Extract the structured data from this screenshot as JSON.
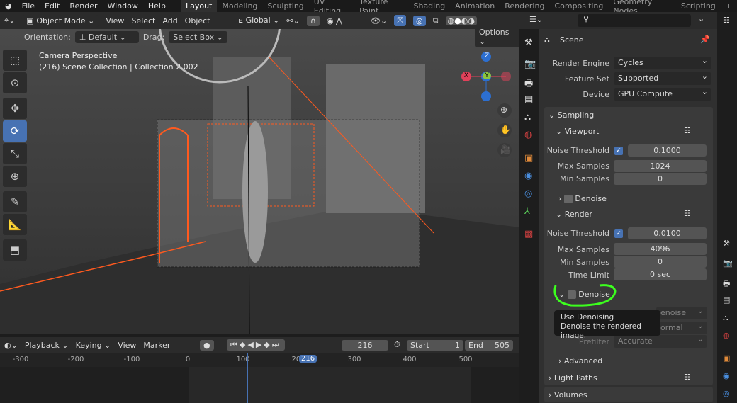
{
  "menu": {
    "items": [
      "File",
      "Edit",
      "Render",
      "Window",
      "Help"
    ]
  },
  "workspaces": [
    "Layout",
    "Modeling",
    "Sculpting",
    "UV Editing",
    "Texture Paint",
    "Shading",
    "Animation",
    "Rendering",
    "Compositing",
    "Geometry Nodes",
    "Scripting",
    "+"
  ],
  "header": {
    "mode": "Object Mode",
    "menus": [
      "View",
      "Select",
      "Add",
      "Object"
    ],
    "orientation": "Global"
  },
  "tool_options": {
    "orientation_label": "Orientation:",
    "orientation": "Default",
    "drag_label": "Drag:",
    "drag": "Select Box",
    "options": "Options"
  },
  "viewport": {
    "camera": "Camera Perspective",
    "collection": "(216) Scene Collection | Collection 2.002",
    "gizmo": {
      "z": "Z",
      "y": "Y",
      "x": "X"
    }
  },
  "timeline": {
    "menus": [
      "Playback",
      "Keying",
      "View",
      "Marker"
    ],
    "current_frame": "216",
    "start_label": "Start",
    "start": "1",
    "end_label": "End",
    "end": "505",
    "ticks": [
      "-300",
      "-200",
      "-100",
      "0",
      "100",
      "200",
      "300",
      "400",
      "500"
    ],
    "playhead": "216"
  },
  "properties": {
    "title": "Scene",
    "render_engine_label": "Render Engine",
    "render_engine": "Cycles",
    "feature_set_label": "Feature Set",
    "feature_set": "Supported",
    "device_label": "Device",
    "device": "GPU Compute",
    "sampling": "Sampling",
    "viewport": {
      "title": "Viewport",
      "noise_label": "Noise Threshold",
      "noise": "0.1000",
      "max_label": "Max Samples",
      "max": "1024",
      "min_label": "Min Samples",
      "min": "0",
      "denoise": "Denoise"
    },
    "render": {
      "title": "Render",
      "noise_label": "Noise Threshold",
      "noise": "0.0100",
      "max_label": "Max Samples",
      "max": "4096",
      "min_label": "Min Samples",
      "min": "0",
      "time_label": "Time Limit",
      "time": "0 sec",
      "denoise": "Denoise",
      "denoiser_partial": "enoise",
      "passes_partial": "ormal",
      "prefilter_label": "Prefilter",
      "prefilter": "Accurate"
    },
    "advanced": "Advanced",
    "light_paths": "Light Paths",
    "volumes": "Volumes"
  },
  "tooltip": {
    "title": "Use Denoising",
    "desc": "Denoise the rendered image."
  },
  "colors": {
    "accent": "#4772b3",
    "highlight_circle": "#3cff1e",
    "selection": "#ff5a1f"
  }
}
